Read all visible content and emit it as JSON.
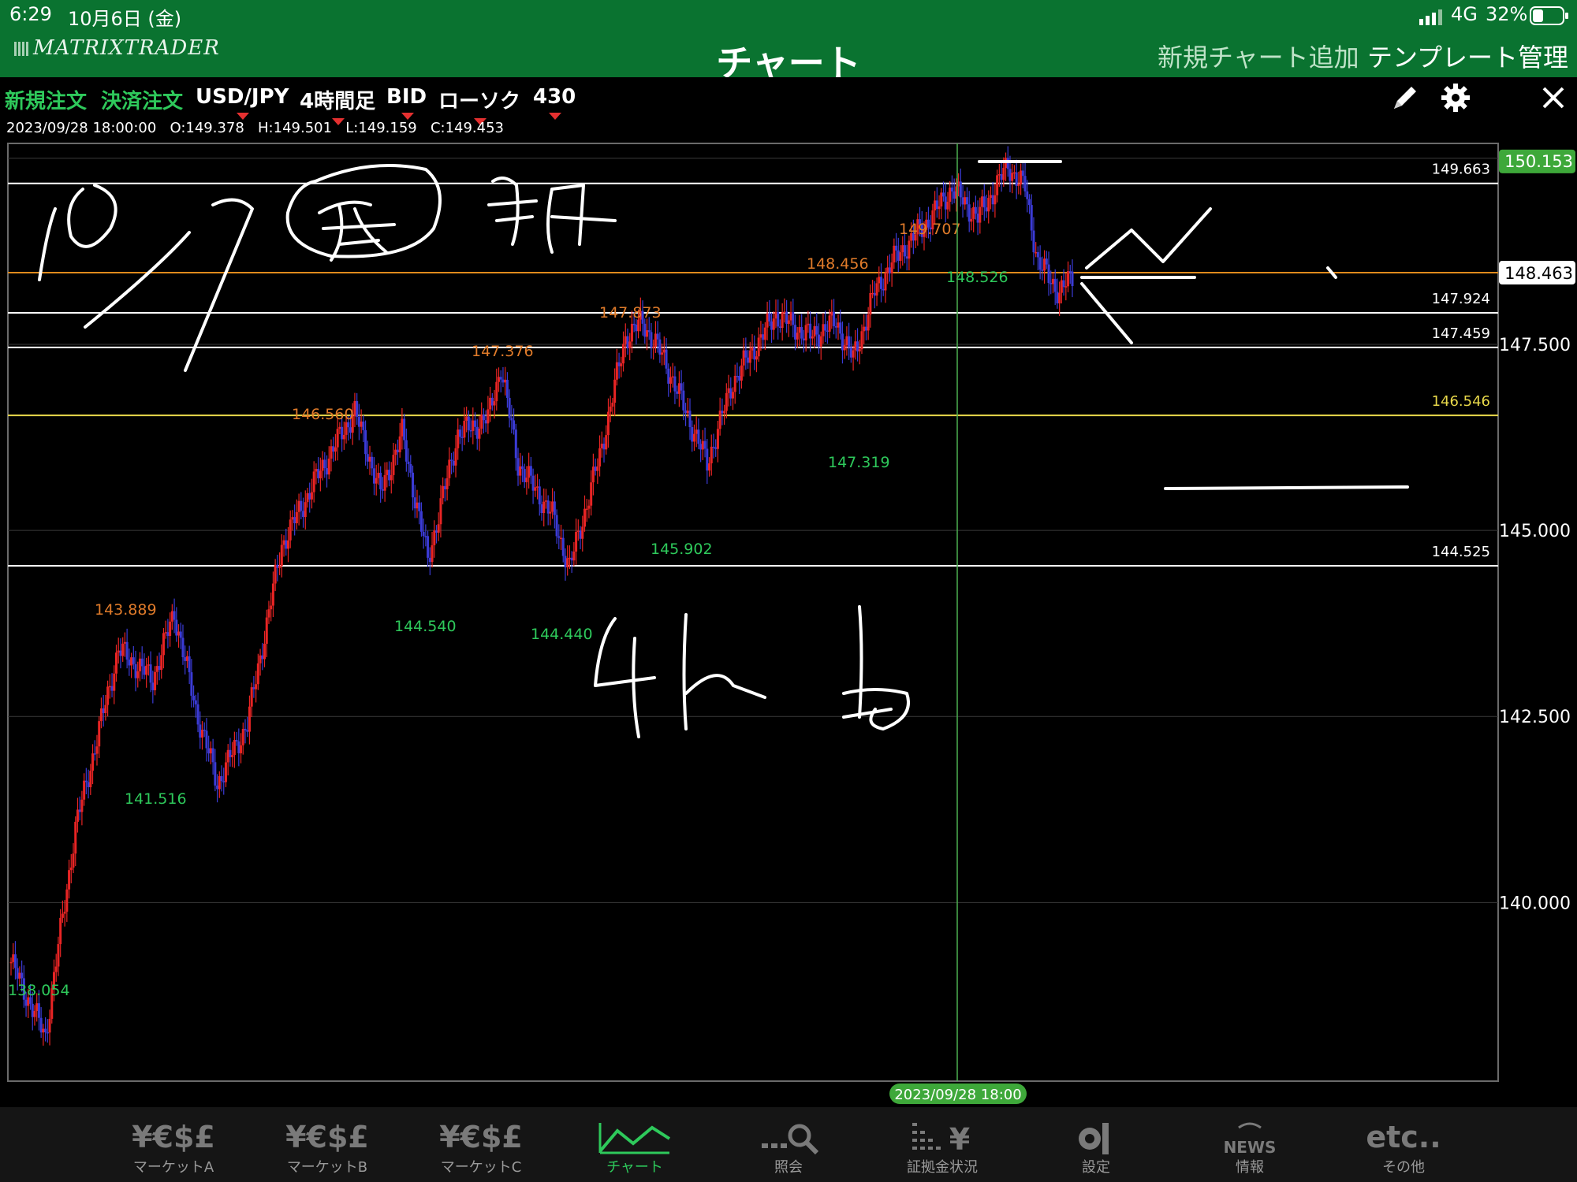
{
  "status": {
    "time": "6:29",
    "date": "10月6日 (金)",
    "network": "4G",
    "battery": "32%"
  },
  "header": {
    "logo": "MATRIXTRADER",
    "title": "チャート",
    "add_chart": "新規チャート追加",
    "template": "テンプレート管理"
  },
  "toolbar": {
    "new_order": "新規注文",
    "close_order": "決済注文",
    "pair": "USD/JPY",
    "timeframe": "4時間足",
    "price_type": "BID",
    "chart_style": "ローソク",
    "count": "430"
  },
  "ohlc": {
    "datetime": "2023/09/28 18:00:00",
    "open": "O:149.378",
    "high": "H:149.501",
    "low": "L:149.159",
    "close": "C:149.453"
  },
  "chart_data": {
    "type": "candlestick",
    "y_ticks": [
      "150.000",
      "147.500",
      "145.000",
      "142.500",
      "140.000"
    ],
    "ylim": [
      137.6,
      150.2
    ],
    "current_price": "150.153",
    "highlight_price": "148.463",
    "crosshair_date": "2023/09/28 18:00",
    "horizontal_lines": [
      {
        "price": 149.663,
        "label": "149.663",
        "color": "#ffffff"
      },
      {
        "price": 148.463,
        "label": "",
        "color": "#e08a1c"
      },
      {
        "price": 147.924,
        "label": "147.924",
        "color": "#ffffff"
      },
      {
        "price": 147.459,
        "label": "147.459",
        "color": "#ffffff"
      },
      {
        "price": 146.546,
        "label": "146.546",
        "color": "#e8d84a"
      },
      {
        "price": 144.525,
        "label": "144.525",
        "color": "#ffffff"
      }
    ],
    "high_markers": [
      "143.889",
      "146.560",
      "147.376",
      "147.873",
      "148.456",
      "149.707"
    ],
    "low_markers": [
      "138.054",
      "141.516",
      "144.540",
      "144.440",
      "145.902",
      "147.319",
      "148.526"
    ],
    "price_path": [
      [
        0,
        139.2
      ],
      [
        8,
        138.2
      ],
      [
        15,
        141.0
      ],
      [
        25,
        143.4
      ],
      [
        33,
        143.0
      ],
      [
        38,
        143.9
      ],
      [
        43,
        142.6
      ],
      [
        48,
        141.6
      ],
      [
        55,
        142.4
      ],
      [
        63,
        144.8
      ],
      [
        72,
        145.8
      ],
      [
        80,
        146.6
      ],
      [
        86,
        145.5
      ],
      [
        91,
        146.3
      ],
      [
        97,
        144.6
      ],
      [
        104,
        146.3
      ],
      [
        111,
        146.5
      ],
      [
        114,
        147.2
      ],
      [
        118,
        145.9
      ],
      [
        126,
        145.2
      ],
      [
        130,
        144.5
      ],
      [
        137,
        146.0
      ],
      [
        143,
        147.6
      ],
      [
        147,
        147.8
      ],
      [
        152,
        147.3
      ],
      [
        157,
        146.6
      ],
      [
        162,
        145.9
      ],
      [
        168,
        147.0
      ],
      [
        178,
        147.9
      ],
      [
        186,
        147.6
      ],
      [
        192,
        147.8
      ],
      [
        196,
        147.3
      ],
      [
        201,
        148.2
      ],
      [
        205,
        148.6
      ],
      [
        214,
        149.2
      ],
      [
        219,
        149.6
      ],
      [
        225,
        149.2
      ],
      [
        232,
        149.9
      ],
      [
        236,
        149.6
      ],
      [
        239,
        148.6
      ],
      [
        244,
        148.2
      ],
      [
        247,
        148.4
      ]
    ]
  },
  "annotations": {
    "date_note": "10/7",
    "circled_char": "金",
    "morning": "朝",
    "timeframe_note": "4h 足"
  },
  "bottom_nav": [
    {
      "icon": "¥€$£",
      "label": "マーケットA"
    },
    {
      "icon": "¥€$£",
      "label": "マーケットB"
    },
    {
      "icon": "¥€$£",
      "label": "マーケットC"
    },
    {
      "icon": "chart-line",
      "label": "チャート"
    },
    {
      "icon": "search",
      "label": "照会"
    },
    {
      "icon": "bars-yen",
      "label": "証拠金状況"
    },
    {
      "icon": "gear-wrench",
      "label": "設定"
    },
    {
      "icon": "NEWS",
      "label": "情報"
    },
    {
      "icon": "etc..",
      "label": "その他"
    }
  ]
}
